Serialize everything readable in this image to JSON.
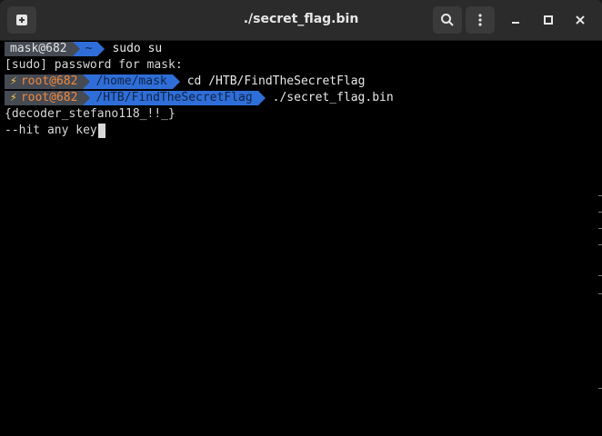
{
  "window": {
    "title": "./secret_flag.bin"
  },
  "prompt1": {
    "user": "mask@682",
    "dir": "~",
    "command": "sudo su"
  },
  "sudo_prompt": "[sudo] password for mask:",
  "prompt2": {
    "bolt": "⚡",
    "user": "root@682",
    "dir": "/home/mask",
    "command": "cd /HTB/FindTheSecretFlag"
  },
  "prompt3": {
    "bolt": "⚡",
    "user": "root@682",
    "dir": "/HTB/FindTheSecretFlag",
    "command": "./secret_flag.bin"
  },
  "output": [
    "{decoder_stefano118_!!_}",
    "--hit any key"
  ],
  "colors": {
    "accent_blue": "#2f6ed8",
    "segment_grey": "#454a53",
    "root_orange": "#f0883e",
    "bolt_yellow": "#f7c64a"
  },
  "icons": [
    "new-tab-icon",
    "search-icon",
    "menu-icon",
    "minimize-icon",
    "maximize-icon",
    "close-icon"
  ]
}
